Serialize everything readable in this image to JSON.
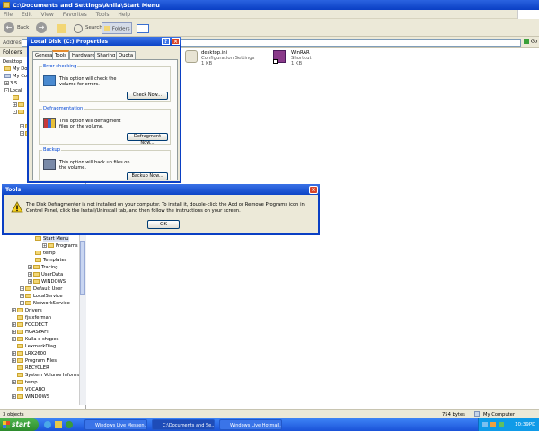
{
  "window": {
    "title": "C:\\Documents and Settings\\Anila\\Start Menu"
  },
  "menu": [
    "File",
    "Edit",
    "View",
    "Favorites",
    "Tools",
    "Help"
  ],
  "toolbar": {
    "back": "Back",
    "search": "Search",
    "folders": "Folders"
  },
  "address": {
    "label": "Address",
    "go": "Go"
  },
  "folders_pane": {
    "header": "Folders",
    "top_items": [
      "Desktop",
      "My Docu",
      "My Comp",
      "3.5",
      "Local"
    ],
    "items": [
      "Start Menu",
      "Programs",
      "temp",
      "Templates",
      "Tracing",
      "UserData",
      "WINDOWS",
      "Default User",
      "LocalService",
      "NetworkService",
      "Drivers",
      "fjslxferman",
      "FOCDECT",
      "HGASPAFI",
      "Kulla e shqpes",
      "LexmarkDiag",
      "LRX2600",
      "Program Files",
      "RECYCLER",
      "System Volume Informati",
      "temp",
      "VOCABO",
      "WINDOWS"
    ]
  },
  "files": [
    {
      "name": "desktop.ini",
      "line2": "Configuration Settings",
      "line3": "1 KB"
    },
    {
      "name": "WinRAR",
      "line2": "Shortcut",
      "line3": "1 KB"
    }
  ],
  "properties": {
    "title": "Local Disk (C:) Properties",
    "tabs": [
      "General",
      "Tools",
      "Hardware",
      "Sharing",
      "Quota"
    ],
    "active_tab": "Tools",
    "groups": [
      {
        "title": "Error-checking",
        "text": "This option will check the volume for errors.",
        "button": "Check Now..."
      },
      {
        "title": "Defragmentation",
        "text": "This option will defragment files on the volume.",
        "button": "Defragment Now..."
      },
      {
        "title": "Backup",
        "text": "This option will back up files on the volume.",
        "button": "Backup Now..."
      }
    ]
  },
  "tools_dialog": {
    "title": "Tools",
    "message": "The Disk Defragmenter is not installed on your computer. To install it, double-click the Add or Remove Programs icon in Control Panel, click the Install/Uninstall tab, and then follow the instructions on your screen.",
    "ok": "OK"
  },
  "statusbar": {
    "objects": "3 objects",
    "size": "754 bytes",
    "location": "My Computer"
  },
  "taskbar": {
    "start": "start",
    "tasks": [
      "Windows Live Messen...",
      "C:\\Documents and Se...",
      "Windows Live Hotmail..."
    ],
    "clock": "10:39PD"
  },
  "colors": {
    "title_blue": "#0a3fc4",
    "taskbar_blue": "#1a52d8",
    "start_green": "#2c8a2c"
  }
}
